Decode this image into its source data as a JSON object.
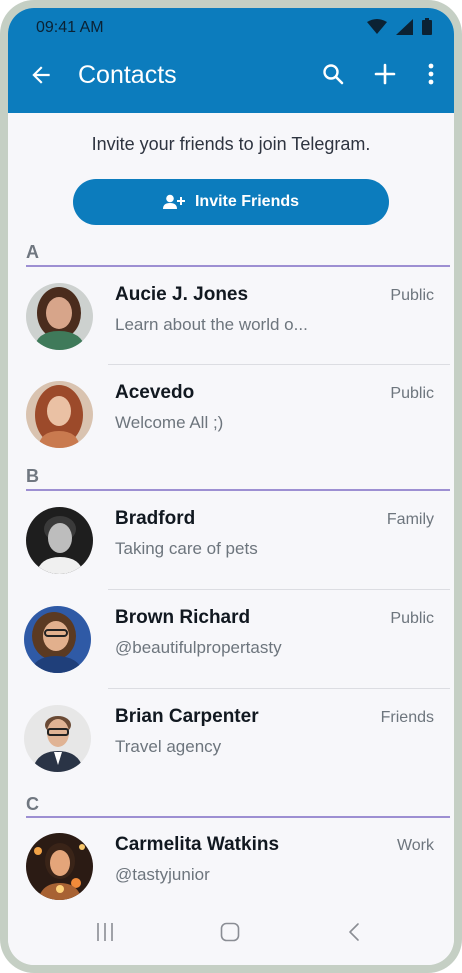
{
  "status_bar": {
    "time": "09:41 AM",
    "icons": [
      "wifi-icon",
      "signal-icon",
      "battery-icon"
    ]
  },
  "app_bar": {
    "title": "Contacts",
    "icons": [
      "back-arrow-icon",
      "search-icon",
      "plus-icon",
      "more-vertical-icon"
    ]
  },
  "invite": {
    "text": "Invite your friends to join Telegram.",
    "button_label": "Invite Friends",
    "button_icon": "add-person-icon"
  },
  "sections": [
    {
      "letter": "A",
      "contacts": [
        {
          "name": "Aucie J. Jones",
          "status": "Learn about the world o...",
          "tag": "Public"
        },
        {
          "name": "Acevedo",
          "status": "Welcome All ;)",
          "tag": "Public"
        }
      ]
    },
    {
      "letter": "B",
      "contacts": [
        {
          "name": "Bradford",
          "status": "Taking care of pets",
          "tag": "Family"
        },
        {
          "name": "Brown Richard",
          "status": "@beautifulpropertasty",
          "tag": "Public"
        },
        {
          "name": "Brian Carpenter",
          "status": "Travel agency",
          "tag": "Friends"
        }
      ]
    },
    {
      "letter": "C",
      "contacts": [
        {
          "name": "Carmelita Watkins",
          "status": "@tastyjunior",
          "tag": "Work"
        }
      ]
    }
  ],
  "nav_bar": {
    "icons": [
      "recent-apps-icon",
      "home-icon",
      "back-icon"
    ]
  },
  "colors": {
    "primary": "#0c7cbd",
    "section_line": "#9d8fd2",
    "frame": "#c5cfc4"
  }
}
